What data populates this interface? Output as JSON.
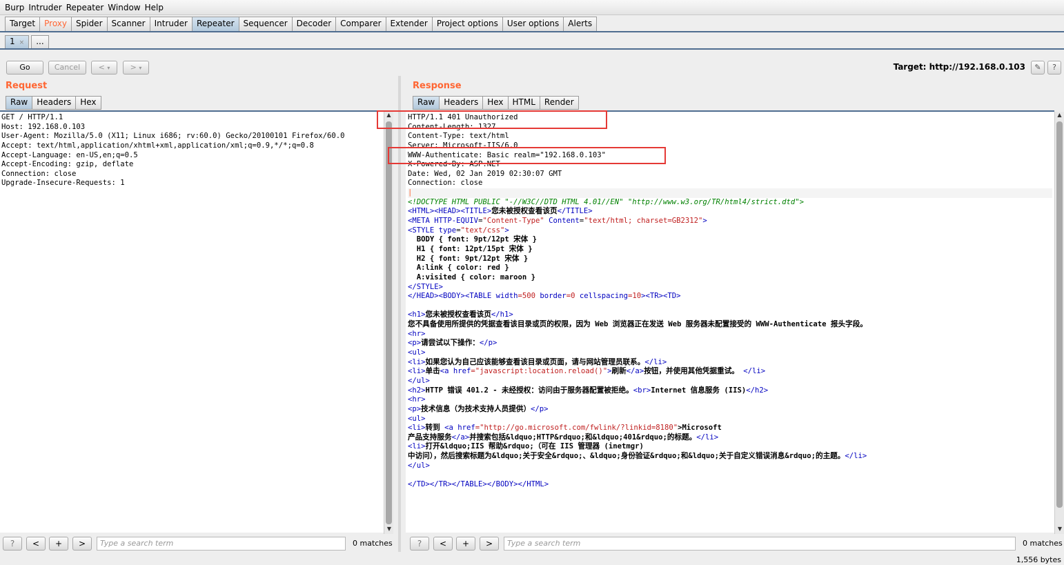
{
  "menu": [
    "Burp",
    "Intruder",
    "Repeater",
    "Window",
    "Help"
  ],
  "main_tabs": [
    "Target",
    "Proxy",
    "Spider",
    "Scanner",
    "Intruder",
    "Repeater",
    "Sequencer",
    "Decoder",
    "Comparer",
    "Extender",
    "Project options",
    "User options",
    "Alerts"
  ],
  "selected_main_tab": "Repeater",
  "sub_tabs": {
    "first": "1",
    "first_close": "×",
    "more": "..."
  },
  "toolbar": {
    "go": "Go",
    "cancel": "Cancel",
    "back": "<",
    "forward": ">",
    "dropdown": "▾",
    "target": "Target: http://192.168.0.103",
    "edit_icon": "✎",
    "help_icon": "?"
  },
  "request": {
    "title": "Request",
    "tabs": [
      "Raw",
      "Headers",
      "Hex"
    ],
    "lines": [
      "GET / HTTP/1.1",
      "Host: 192.168.0.103",
      "User-Agent: Mozilla/5.0 (X11; Linux i686; rv:60.0) Gecko/20100101 Firefox/60.0",
      "Accept: text/html,application/xhtml+xml,application/xml;q=0.9,*/*;q=0.8",
      "Accept-Language: en-US,en;q=0.5",
      "Accept-Encoding: gzip, deflate",
      "Connection: close",
      "Upgrade-Insecure-Requests: 1"
    ],
    "search": {
      "help": "?",
      "prev": "<",
      "add": "+",
      "next": ">",
      "placeholder": "Type a search term",
      "matches": "0 matches"
    }
  },
  "response": {
    "title": "Response",
    "tabs": [
      "Raw",
      "Headers",
      "Hex",
      "HTML",
      "Render"
    ],
    "headers": [
      "HTTP/1.1 401 Unauthorized",
      "Content-Length: 1327",
      "Content-Type: text/html",
      "Server: Microsoft-IIS/6.0",
      "WWW-Authenticate: Basic realm=\"192.168.0.103\"",
      "X-Powered-By: ASP.NET",
      "Date: Wed, 02 Jan 2019 02:30:07 GMT",
      "Connection: close"
    ],
    "body": {
      "doctype": "<!DOCTYPE HTML PUBLIC \"-//W3C//DTD HTML 4.01//EN\" \"http://www.w3.org/TR/html4/strict.dtd\">",
      "html_open": "<HTML>",
      "head_open": "<HEAD>",
      "title_open": "<TITLE>",
      "title_text": "您未被授权查看该页",
      "title_close": "</TITLE>",
      "meta_tag": "<META",
      "meta_equiv_attr": "HTTP-EQUIV",
      "meta_equiv_val": "\"Content-Type\"",
      "meta_content_attr": "Content",
      "meta_content_val": "\"text/html; charset=GB2312\"",
      "meta_close": ">",
      "style_tag": "<STYLE",
      "style_type_attr": "type",
      "style_type_val": "\"text/css\"",
      "style_close": ">",
      "css_lines": [
        "  BODY { font: 9pt/12pt 宋体 }",
        "  H1 { font: 12pt/15pt 宋体 }",
        "  H2 { font: 9pt/12pt 宋体 }",
        "  A:link { color: red }",
        "  A:visited { color: maroon }"
      ],
      "style_end": "</STYLE>",
      "head_close": "</HEAD>",
      "body_open": "<BODY>",
      "table_tag": "<TABLE",
      "table_width_attr": "width",
      "table_width_val": "=500",
      "table_border_attr": "border",
      "table_border_val": "=0",
      "table_cs_attr": "cellspacing",
      "table_cs_val": "=10",
      "tr_td": "><TR><TD>",
      "h1_open": "<h1>",
      "h1_text": "您未被授权查看该页",
      "h1_close": "</h1>",
      "desc_text": "您不具备使用所提供的凭据查看该目录或页的权限，因为 Web 浏览器正在发送 Web 服务器未配置接受的 WWW-Authenticate 报头字段。",
      "hr": "<hr>",
      "p_open": "<p>",
      "p_text": "请尝试以下操作：",
      "p_close": "</p>",
      "ul_open": "<ul>",
      "li_open": "<li>",
      "li1_text": "如果您认为自己应该能够查看该目录或页面，请与网站管理员联系。",
      "li_close": "</li>",
      "li2_pre": "单击",
      "a_tag": "<a",
      "href_attr": "href",
      "href1_val": "=\"javascript:location.reload()\"",
      "a_gt": ">",
      "li2_link": "刷新",
      "a_close": "</a>",
      "li2_post": "按钮，并使用其他凭据重试。",
      "ul_close": "</ul>",
      "h2_open": "<h2>",
      "h2_text": "HTTP 错误 401.2 - 未经授权：访问由于服务器配置被拒绝。",
      "br": "<br>",
      "h2_text2": "Internet 信息服务 (IIS)",
      "h2_close": "</h2>",
      "p2_text": "技术信息（为技术支持人员提供）",
      "li3_pre": "转到 ",
      "href3_val": "=\"http://go.microsoft.com/fwlink/?linkid=8180\"",
      "li3_link": ">Microsoft",
      "li3_line2": "产品支持服务",
      "li3_post": "并搜索包括&ldquo;HTTP&rdquo;和&ldquo;401&rdquo;的标题。",
      "li4_text": "打开&ldquo;IIS 帮助&rdquo;（可在 IIS 管理器 (inetmgr)",
      "li4_line2": "中访问），然后搜索标题为&ldquo;关于安全&rdquo;、&ldquo;身份验证&rdquo;和&ldquo;关于自定义错误消息&rdquo;的主题。",
      "end_tags": "</TD></TR></TABLE></BODY></HTML>",
      "end_td": "</TD>",
      "end_tr": "</TR>",
      "end_table": "</TABLE>",
      "end_body": "</BODY>",
      "end_html": "</HTML>"
    },
    "search": {
      "help": "?",
      "prev": "<",
      "add": "+",
      "next": ">",
      "placeholder": "Type a search term",
      "matches": "0 matches"
    },
    "size": "1,556 bytes"
  },
  "colors": {
    "accent": "#ff6633",
    "tag": "#0000c0",
    "value": "#c02020",
    "doctype": "#008000",
    "highlight_box": "#e53935"
  }
}
